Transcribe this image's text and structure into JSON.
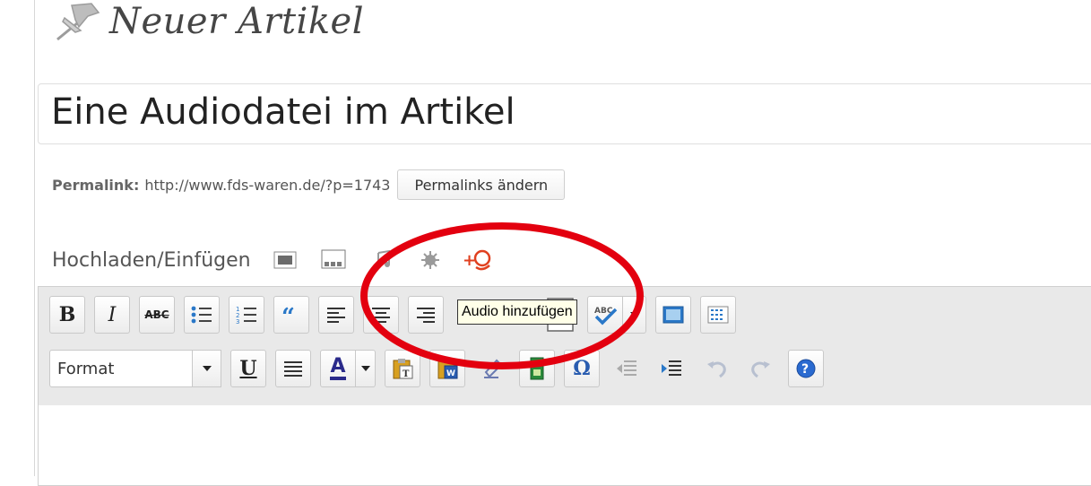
{
  "header": {
    "title": "Neuer Artikel",
    "icon": "pushpin-icon"
  },
  "post": {
    "title_value": "Eine Audiodatei im Artikel"
  },
  "permalink": {
    "label": "Permalink:",
    "url": "http://www.fds-waren.de/?p=1743",
    "button": "Permalinks ändern"
  },
  "upload": {
    "label": "Hochladen/Einfügen",
    "icons": [
      "image-icon",
      "gallery-icon",
      "music-icon",
      "media-icon",
      "add-audio-icon"
    ]
  },
  "toolbar": {
    "row1": [
      "bold",
      "italic",
      "strikethrough",
      "bullet-list",
      "numbered-list",
      "blockquote",
      "align-left",
      "align-center",
      "align-right",
      "link",
      "unlink",
      "more-tag",
      "spellcheck",
      "spellcheck-dropdown",
      "fullscreen",
      "kitchen-sink"
    ],
    "bold_label": "B",
    "italic_label": "I",
    "strike_label": "ABC",
    "format_value": "Format",
    "underline_label": "U",
    "textcolor_label": "A",
    "omega_label": "Ω",
    "help_label": "?"
  },
  "tooltip": {
    "text": "Audio hinzufügen"
  },
  "colors": {
    "highlight": "#e3000f",
    "toolbar_bg": "#e9e9e9",
    "tooltip_bg": "#ffffe8"
  }
}
